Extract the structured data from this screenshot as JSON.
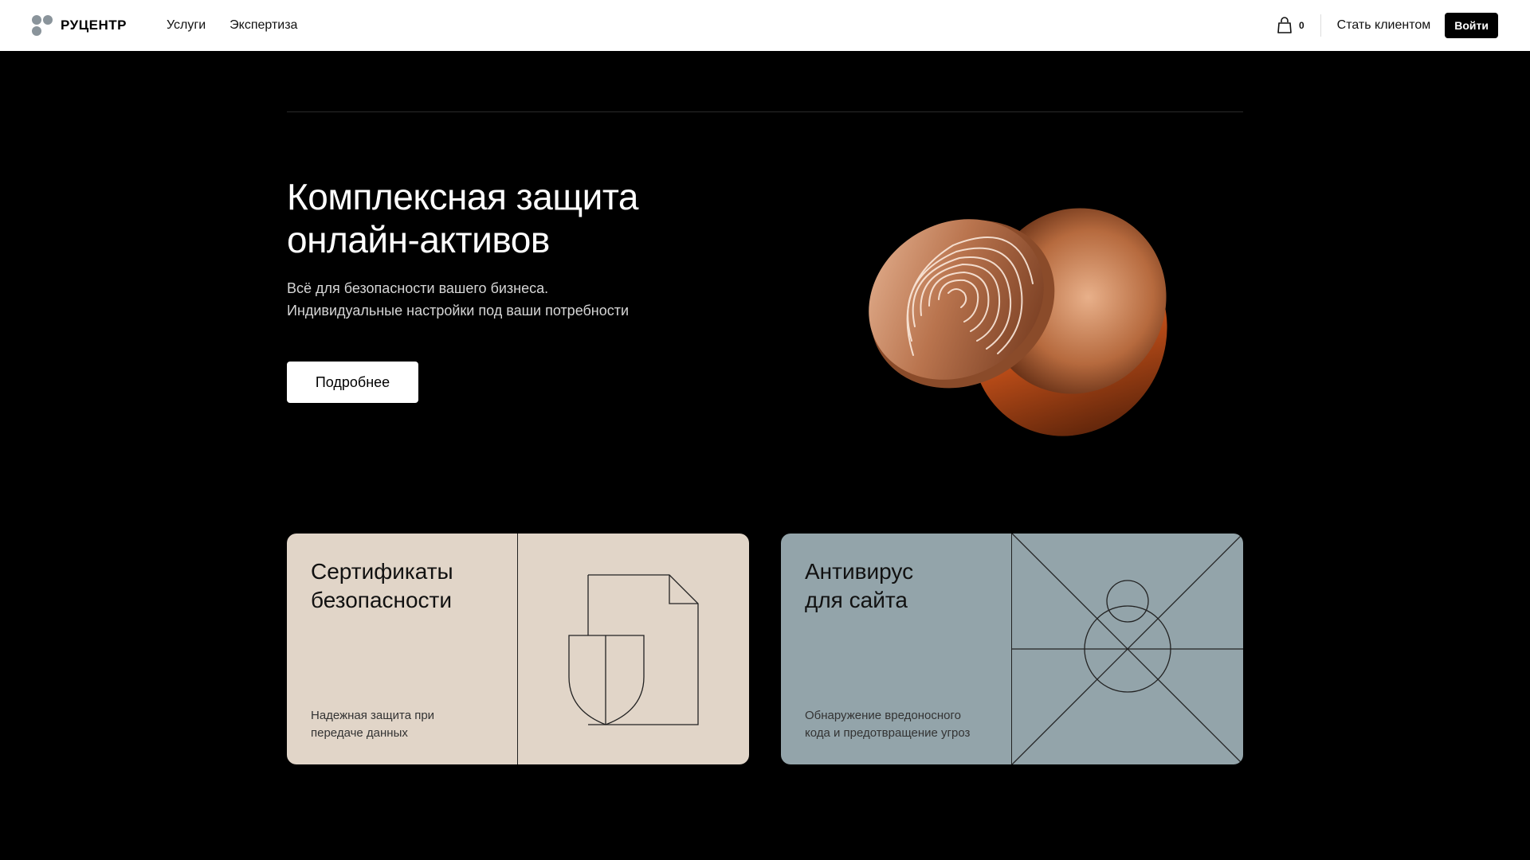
{
  "header": {
    "logo_text": "РУЦЕНТР",
    "nav": [
      "Услуги",
      "Экспертиза"
    ],
    "cart_count": "0",
    "become_client": "Стать клиентом",
    "login": "Войти"
  },
  "hero": {
    "title": "Комплексная защита онлайн-активов",
    "subtitle_line1": "Всё для безопасности вашего бизнеса.",
    "subtitle_line2": "Индивидуальные настройки под ваши потребности",
    "cta": "Подробнее"
  },
  "cards": [
    {
      "title_line1": "Сертификаты",
      "title_line2": "безопасности",
      "desc_line1": "Надежная защита при",
      "desc_line2": "передаче данных",
      "icon": "shield-document-icon",
      "bg": "#e1d5c8"
    },
    {
      "title_line1": "Антивирус",
      "title_line2": "для сайта",
      "desc_line1": "Обнаружение вредоносного",
      "desc_line2": "кода и предотвращение угроз",
      "icon": "bug-crosshair-icon",
      "bg": "#93a4aa"
    }
  ],
  "colors": {
    "accent_copper": "#c0784e",
    "dark": "#000000",
    "light": "#ffffff"
  }
}
